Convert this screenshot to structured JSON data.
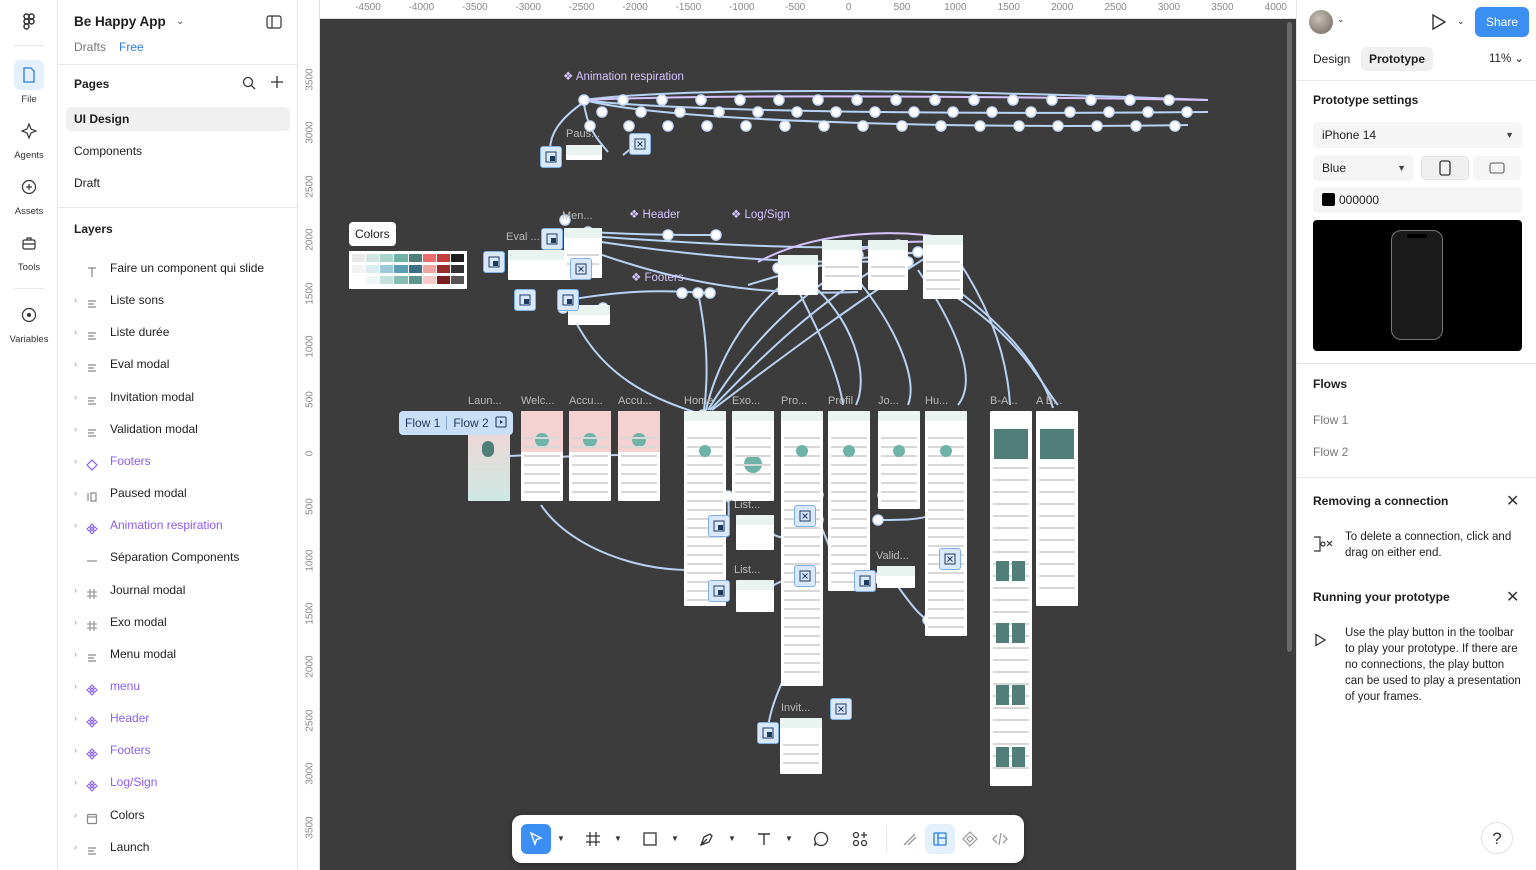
{
  "leftbar": {
    "items": [
      {
        "label": "File",
        "icon": "file-icon"
      },
      {
        "label": "Agents",
        "icon": "sparkle-icon"
      },
      {
        "label": "Assets",
        "icon": "plus-circle-icon"
      },
      {
        "label": "Tools",
        "icon": "toolbox-icon"
      },
      {
        "label": "Variables",
        "icon": "variables-icon"
      }
    ]
  },
  "project": {
    "name": "Be Happy App",
    "location": "Drafts",
    "plan": "Free"
  },
  "pages": {
    "title": "Pages",
    "items": [
      "UI Design",
      "Components",
      "Draft"
    ],
    "selected": "UI Design"
  },
  "layers": {
    "title": "Layers",
    "items": [
      {
        "label": "Faire un component qui slide",
        "type": "text"
      },
      {
        "label": "Liste sons",
        "type": "frame-auto"
      },
      {
        "label": "Liste durée",
        "type": "frame-auto"
      },
      {
        "label": "Eval modal",
        "type": "frame-auto"
      },
      {
        "label": "Invitation modal",
        "type": "frame-auto"
      },
      {
        "label": "Validation modal",
        "type": "frame-auto"
      },
      {
        "label": "Footers",
        "type": "component-set"
      },
      {
        "label": "Paused modal",
        "type": "frame-col"
      },
      {
        "label": "Animation respiration",
        "type": "component"
      },
      {
        "label": "Séparation Components",
        "type": "line"
      },
      {
        "label": "Journal modal",
        "type": "frame"
      },
      {
        "label": "Exo modal",
        "type": "frame"
      },
      {
        "label": "Menu modal",
        "type": "frame-auto"
      },
      {
        "label": "menu",
        "type": "component"
      },
      {
        "label": "Header",
        "type": "component"
      },
      {
        "label": "Footers",
        "type": "component"
      },
      {
        "label": "Log/Sign",
        "type": "component"
      },
      {
        "label": "Colors",
        "type": "section"
      },
      {
        "label": "Launch",
        "type": "frame-auto"
      }
    ]
  },
  "canvas": {
    "ruler_x": [
      "-4500",
      "-4000",
      "-3500",
      "-3000",
      "-2500",
      "-2000",
      "-1500",
      "-1000",
      "-500",
      "0",
      "500",
      "1000",
      "1500",
      "2000",
      "2500",
      "3000",
      "3500",
      "4000"
    ],
    "ruler_y": [
      "3500",
      "3000",
      "2500",
      "2000",
      "1500",
      "1000",
      "500",
      "0",
      "500",
      "1000",
      "1500",
      "2000",
      "2500",
      "3000",
      "3500"
    ],
    "colors_label": "Colors",
    "component_labels": {
      "animation": "Animation respiration",
      "header": "Header",
      "logsign": "Log/Sign",
      "footers": "Footers"
    },
    "frame_labels": {
      "launch": "Laun...",
      "welcome": "Welc...",
      "accueil1": "Accu...",
      "accueil2": "Accu...",
      "home": "Home",
      "exo": "Exo...",
      "pro1": "Pro...",
      "pro2": "Profil",
      "jo": "Jo...",
      "hu": "Hu...",
      "ba": "B-A...",
      "ab": "A B...",
      "eval": "Eval ...",
      "menu": "Men...",
      "list1": "List...",
      "list2": "List...",
      "valid": "Valid...",
      "invit": "Invit...",
      "paus": "Paus..."
    },
    "flows": [
      "Flow 1",
      "Flow 2"
    ]
  },
  "toolbar": {
    "tools": [
      "move-tool",
      "frame-tool",
      "shape-tool",
      "pen-tool",
      "text-tool",
      "comment-tool",
      "actions-tool",
      "draw-mode",
      "design-mode",
      "prototype-mode",
      "dev-mode"
    ]
  },
  "rightpanel": {
    "share_label": "Share",
    "tabs": [
      "Design",
      "Prototype"
    ],
    "selected_tab": "Prototype",
    "zoom": "11%",
    "settings_title": "Prototype settings",
    "device": "iPhone 14",
    "device_color": "Blue",
    "background_hex": "000000",
    "flows_title": "Flows",
    "flows": [
      "Flow 1",
      "Flow 2"
    ],
    "help1_title": "Removing a connection",
    "help1_text": "To delete a connection, click and drag on either end.",
    "help2_title": "Running your prototype",
    "help2_text": "Use the play button in the toolbar to play your prototype. If there are no connections, the play button can be used to play a presentation of your frames.",
    "help_button": "?"
  },
  "colors": {
    "accent": "#3b8ff2",
    "component": "#8b5cf6",
    "canvas": "#3c3c3c",
    "connector": "#b9d3f5",
    "teal": "#6fb3a8"
  }
}
